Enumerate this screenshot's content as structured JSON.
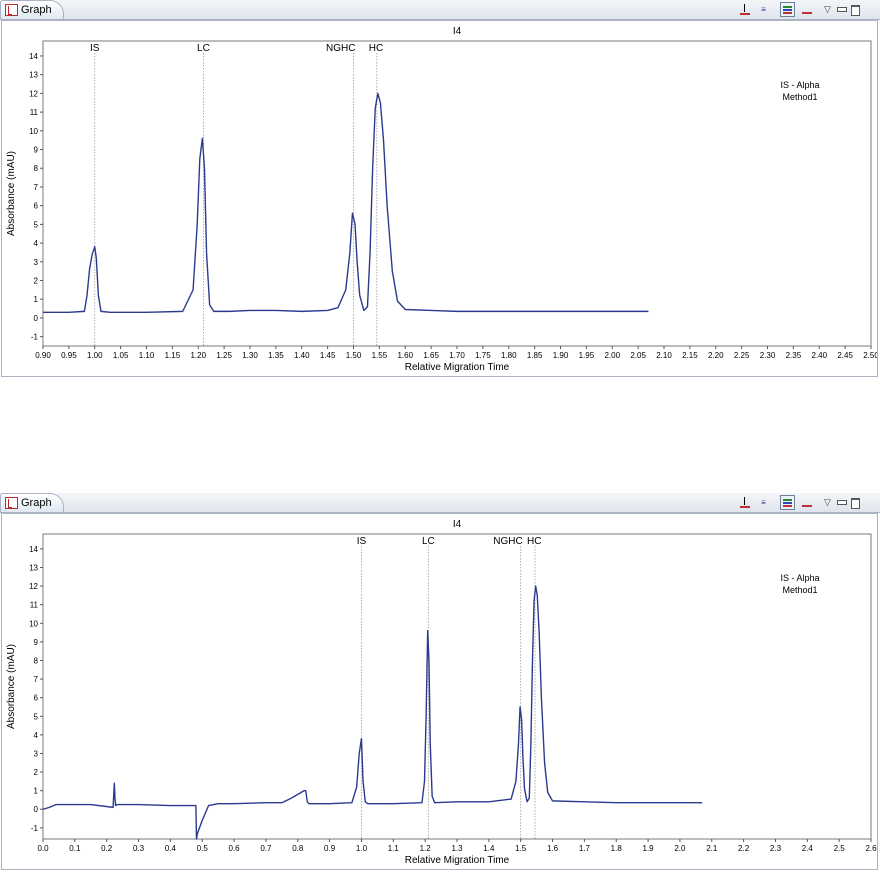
{
  "panels": [
    {
      "tab_label": "Graph",
      "chart_data": {
        "type": "line",
        "title": "I4",
        "xlabel": "Relative Migration Time",
        "ylabel": "Absorbance (mAU)",
        "xlim": [
          0.9,
          2.5
        ],
        "ylim": [
          -1.5,
          14.8
        ],
        "x_ticks": [
          0.9,
          0.95,
          1.0,
          1.05,
          1.1,
          1.15,
          1.2,
          1.25,
          1.3,
          1.35,
          1.4,
          1.45,
          1.5,
          1.55,
          1.6,
          1.65,
          1.7,
          1.75,
          1.8,
          1.85,
          1.9,
          1.95,
          2.0,
          2.05,
          2.1,
          2.15,
          2.2,
          2.25,
          2.3,
          2.35,
          2.4,
          2.45,
          2.5
        ],
        "x_tick_labels": [
          "0.90",
          "0.95",
          "1.00",
          "1.05",
          "1.10",
          "1.15",
          "1.20",
          "1.25",
          "1.30",
          "1.35",
          "1.40",
          "1.45",
          "1.50",
          "1.55",
          "1.60",
          "1.65",
          "1.70",
          "1.75",
          "1.80",
          "1.85",
          "1.90",
          "1.95",
          "2.00",
          "2.05",
          "2.10",
          "2.15",
          "2.20",
          "2.25",
          "2.30",
          "2.35",
          "2.40",
          "2.45",
          "2.50"
        ],
        "y_ticks": [
          -1,
          0,
          1,
          2,
          3,
          4,
          5,
          6,
          7,
          8,
          9,
          10,
          11,
          12,
          13,
          14
        ],
        "grid": false,
        "legend_text": [
          "IS - Alpha",
          "Method1"
        ],
        "line_color": "#2b3a8f",
        "annotations": [
          {
            "label": "IS",
            "x": 1.0
          },
          {
            "label": "LC",
            "x": 1.21
          },
          {
            "label": "NGHC",
            "x": 1.5
          },
          {
            "label": "HC",
            "x": 1.545
          }
        ],
        "series": [
          {
            "x": [
              0.9,
              0.95,
              0.98,
              0.985,
              0.99,
              0.995,
              1.0,
              1.003,
              1.007,
              1.012,
              1.03,
              1.1,
              1.17,
              1.19,
              1.198,
              1.203,
              1.208,
              1.212,
              1.216,
              1.222,
              1.23,
              1.26,
              1.3,
              1.35,
              1.4,
              1.45,
              1.47,
              1.485,
              1.493,
              1.498,
              1.503,
              1.507,
              1.512,
              1.52,
              1.527,
              1.532,
              1.537,
              1.542,
              1.547,
              1.552,
              1.558,
              1.565,
              1.575,
              1.585,
              1.6,
              1.65,
              1.7,
              1.8,
              1.9,
              2.0,
              2.07
            ],
            "y": [
              0.3,
              0.3,
              0.35,
              1.2,
              2.6,
              3.4,
              3.8,
              3.2,
              1.2,
              0.35,
              0.3,
              0.3,
              0.35,
              1.5,
              5.0,
              8.5,
              9.6,
              8.0,
              3.5,
              0.7,
              0.35,
              0.35,
              0.4,
              0.4,
              0.35,
              0.4,
              0.55,
              1.5,
              3.5,
              5.6,
              5.0,
              3.0,
              1.2,
              0.4,
              0.6,
              3.5,
              8.0,
              11.2,
              12.0,
              11.5,
              9.5,
              6.0,
              2.5,
              0.9,
              0.45,
              0.4,
              0.35,
              0.35,
              0.35,
              0.35,
              0.35
            ]
          }
        ]
      }
    },
    {
      "tab_label": "Graph",
      "chart_data": {
        "type": "line",
        "title": "I4",
        "xlabel": "Relative Migration Time",
        "ylabel": "Absorbance (mAU)",
        "xlim": [
          0.0,
          2.6
        ],
        "ylim": [
          -1.6,
          14.8
        ],
        "x_ticks": [
          0.0,
          0.1,
          0.2,
          0.3,
          0.4,
          0.5,
          0.6,
          0.7,
          0.8,
          0.9,
          1.0,
          1.1,
          1.2,
          1.3,
          1.4,
          1.5,
          1.6,
          1.7,
          1.8,
          1.9,
          2.0,
          2.1,
          2.2,
          2.3,
          2.4,
          2.5,
          2.6
        ],
        "x_tick_labels": [
          "0.0",
          "0.1",
          "0.2",
          "0.3",
          "0.4",
          "0.5",
          "0.6",
          "0.7",
          "0.8",
          "0.9",
          "1.0",
          "1.1",
          "1.2",
          "1.3",
          "1.4",
          "1.5",
          "1.6",
          "1.7",
          "1.8",
          "1.9",
          "2.0",
          "2.1",
          "2.2",
          "2.3",
          "2.4",
          "2.5",
          "2.6"
        ],
        "y_ticks": [
          -1,
          0,
          1,
          2,
          3,
          4,
          5,
          6,
          7,
          8,
          9,
          10,
          11,
          12,
          13,
          14
        ],
        "grid": false,
        "legend_text": [
          "IS - Alpha",
          "Method1"
        ],
        "line_color": "#2b3a8f",
        "annotations": [
          {
            "label": "IS",
            "x": 1.0
          },
          {
            "label": "LC",
            "x": 1.21
          },
          {
            "label": "NGHC",
            "x": 1.5
          },
          {
            "label": "HC",
            "x": 1.545
          }
        ],
        "series": [
          {
            "x": [
              0.0,
              0.02,
              0.04,
              0.08,
              0.15,
              0.22,
              0.224,
              0.226,
              0.228,
              0.232,
              0.3,
              0.4,
              0.48,
              0.482,
              0.485,
              0.5,
              0.52,
              0.55,
              0.6,
              0.7,
              0.75,
              0.78,
              0.8,
              0.82,
              0.825,
              0.83,
              0.835,
              0.84,
              0.9,
              0.97,
              0.985,
              0.993,
              1.0,
              1.005,
              1.012,
              1.02,
              1.1,
              1.19,
              1.198,
              1.203,
              1.208,
              1.212,
              1.216,
              1.222,
              1.23,
              1.3,
              1.4,
              1.47,
              1.485,
              1.493,
              1.498,
              1.503,
              1.507,
              1.512,
              1.52,
              1.527,
              1.532,
              1.537,
              1.542,
              1.547,
              1.552,
              1.558,
              1.565,
              1.575,
              1.585,
              1.6,
              1.7,
              1.8,
              1.9,
              2.0,
              2.07
            ],
            "y": [
              0.0,
              0.1,
              0.25,
              0.25,
              0.25,
              0.1,
              1.4,
              0.6,
              0.2,
              0.25,
              0.25,
              0.2,
              0.2,
              -1.6,
              -1.3,
              -0.6,
              0.2,
              0.3,
              0.3,
              0.35,
              0.35,
              0.6,
              0.8,
              1.0,
              1.0,
              0.4,
              0.3,
              0.3,
              0.3,
              0.35,
              1.2,
              3.0,
              3.8,
              1.5,
              0.4,
              0.3,
              0.3,
              0.35,
              1.5,
              5.0,
              9.6,
              8.0,
              3.5,
              0.7,
              0.35,
              0.4,
              0.4,
              0.55,
              1.5,
              3.5,
              5.5,
              4.8,
              2.8,
              1.1,
              0.4,
              0.6,
              3.5,
              8.0,
              11.2,
              12.0,
              11.5,
              9.5,
              6.0,
              2.5,
              0.9,
              0.45,
              0.4,
              0.35,
              0.35,
              0.35,
              0.35
            ]
          }
        ]
      }
    }
  ]
}
